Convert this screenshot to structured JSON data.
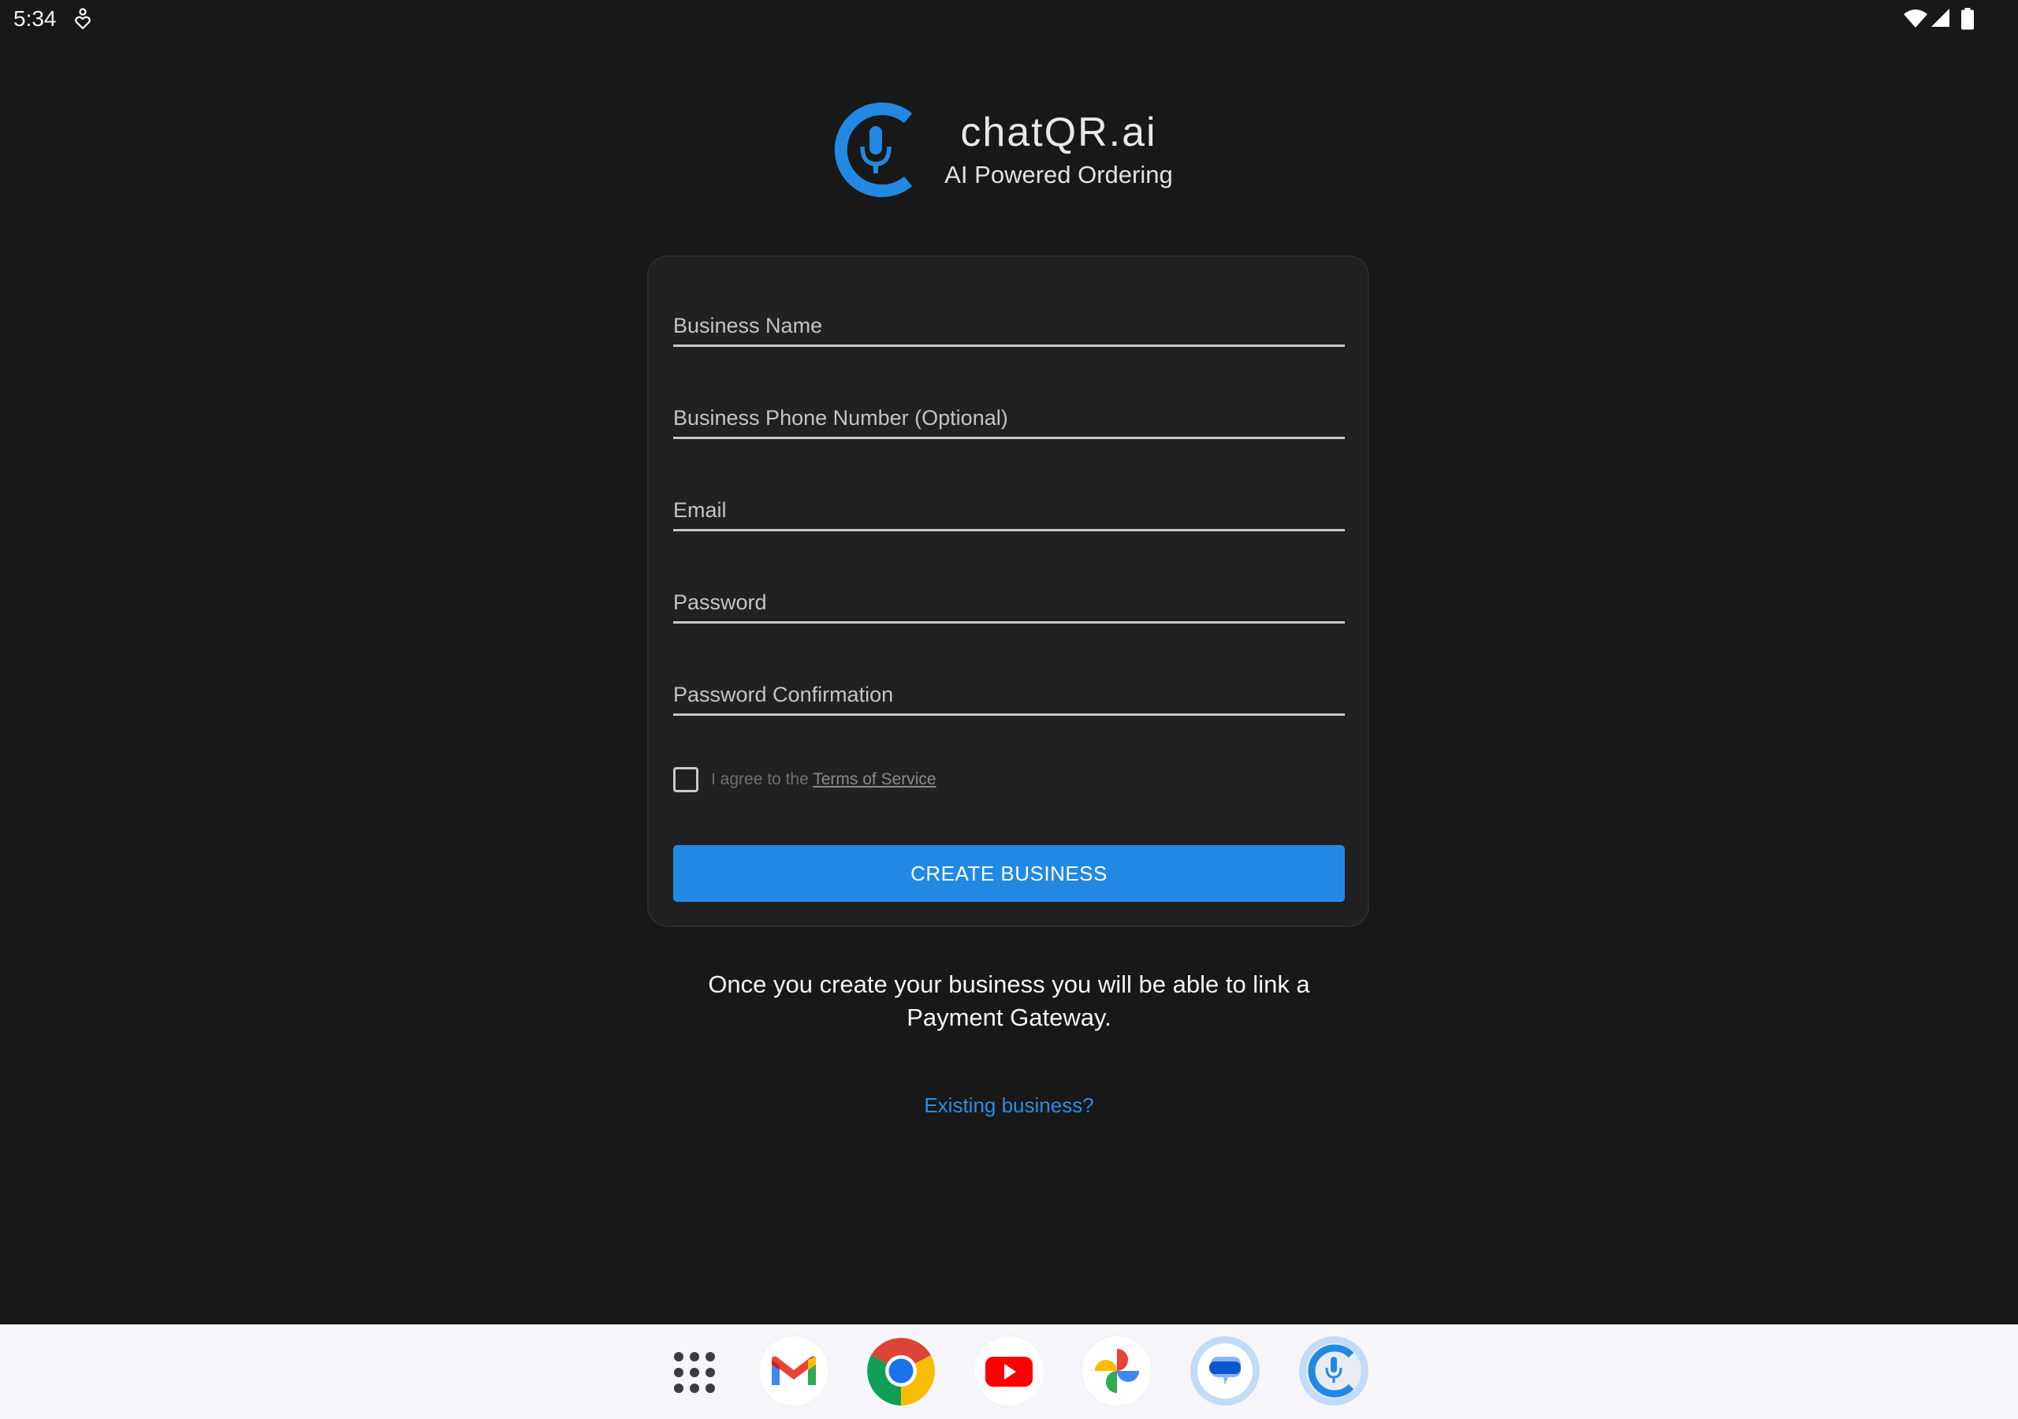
{
  "status_bar": {
    "time": "5:34",
    "icons": [
      "accessibility-icon",
      "wifi-icon",
      "cell-signal-icon",
      "battery-icon"
    ]
  },
  "header": {
    "title": "chatQR.ai",
    "subtitle": "AI Powered Ordering",
    "logo_icon": "chatqr-mic-logo"
  },
  "form": {
    "fields": [
      {
        "label": "Business Name",
        "value": ""
      },
      {
        "label": "Business Phone Number (Optional)",
        "value": ""
      },
      {
        "label": "Email",
        "value": ""
      },
      {
        "label": "Password",
        "value": ""
      },
      {
        "label": "Password Confirmation",
        "value": ""
      }
    ],
    "terms": {
      "checked": false,
      "prefix": "I agree to the ",
      "link_text": "Terms of Service"
    },
    "submit_label": "CREATE BUSINESS"
  },
  "info_text": "Once you create your business you will be able to link a Payment Gateway.",
  "existing_link": "Existing business?",
  "taskbar": {
    "apps": [
      "App drawer",
      "Gmail",
      "Chrome",
      "YouTube",
      "Photos",
      "Messages",
      "chatQR.ai"
    ]
  },
  "colors": {
    "accent": "#2189e3",
    "background": "#181818",
    "card": "#212121",
    "link": "#2b8de6"
  }
}
